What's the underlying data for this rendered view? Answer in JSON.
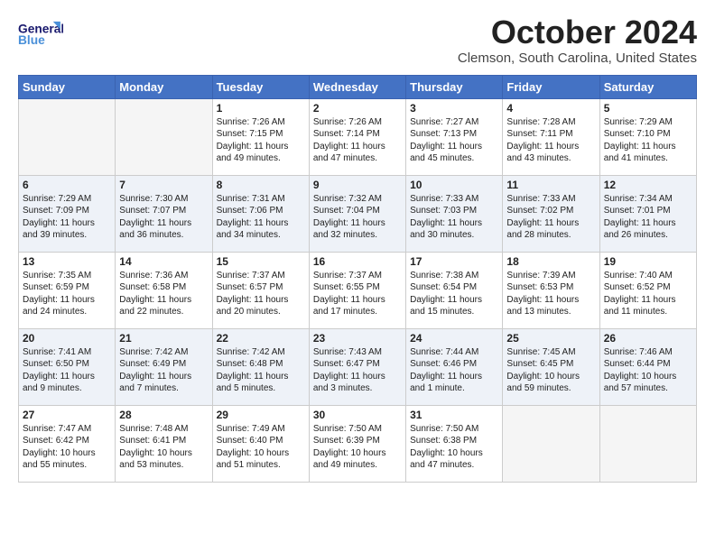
{
  "header": {
    "logo_general": "General",
    "logo_blue": "Blue",
    "month_title": "October 2024",
    "location": "Clemson, South Carolina, United States"
  },
  "days_of_week": [
    "Sunday",
    "Monday",
    "Tuesday",
    "Wednesday",
    "Thursday",
    "Friday",
    "Saturday"
  ],
  "weeks": [
    [
      {
        "day": "",
        "info": ""
      },
      {
        "day": "",
        "info": ""
      },
      {
        "day": "1",
        "info": "Sunrise: 7:26 AM\nSunset: 7:15 PM\nDaylight: 11 hours and 49 minutes."
      },
      {
        "day": "2",
        "info": "Sunrise: 7:26 AM\nSunset: 7:14 PM\nDaylight: 11 hours and 47 minutes."
      },
      {
        "day": "3",
        "info": "Sunrise: 7:27 AM\nSunset: 7:13 PM\nDaylight: 11 hours and 45 minutes."
      },
      {
        "day": "4",
        "info": "Sunrise: 7:28 AM\nSunset: 7:11 PM\nDaylight: 11 hours and 43 minutes."
      },
      {
        "day": "5",
        "info": "Sunrise: 7:29 AM\nSunset: 7:10 PM\nDaylight: 11 hours and 41 minutes."
      }
    ],
    [
      {
        "day": "6",
        "info": "Sunrise: 7:29 AM\nSunset: 7:09 PM\nDaylight: 11 hours and 39 minutes."
      },
      {
        "day": "7",
        "info": "Sunrise: 7:30 AM\nSunset: 7:07 PM\nDaylight: 11 hours and 36 minutes."
      },
      {
        "day": "8",
        "info": "Sunrise: 7:31 AM\nSunset: 7:06 PM\nDaylight: 11 hours and 34 minutes."
      },
      {
        "day": "9",
        "info": "Sunrise: 7:32 AM\nSunset: 7:04 PM\nDaylight: 11 hours and 32 minutes."
      },
      {
        "day": "10",
        "info": "Sunrise: 7:33 AM\nSunset: 7:03 PM\nDaylight: 11 hours and 30 minutes."
      },
      {
        "day": "11",
        "info": "Sunrise: 7:33 AM\nSunset: 7:02 PM\nDaylight: 11 hours and 28 minutes."
      },
      {
        "day": "12",
        "info": "Sunrise: 7:34 AM\nSunset: 7:01 PM\nDaylight: 11 hours and 26 minutes."
      }
    ],
    [
      {
        "day": "13",
        "info": "Sunrise: 7:35 AM\nSunset: 6:59 PM\nDaylight: 11 hours and 24 minutes."
      },
      {
        "day": "14",
        "info": "Sunrise: 7:36 AM\nSunset: 6:58 PM\nDaylight: 11 hours and 22 minutes."
      },
      {
        "day": "15",
        "info": "Sunrise: 7:37 AM\nSunset: 6:57 PM\nDaylight: 11 hours and 20 minutes."
      },
      {
        "day": "16",
        "info": "Sunrise: 7:37 AM\nSunset: 6:55 PM\nDaylight: 11 hours and 17 minutes."
      },
      {
        "day": "17",
        "info": "Sunrise: 7:38 AM\nSunset: 6:54 PM\nDaylight: 11 hours and 15 minutes."
      },
      {
        "day": "18",
        "info": "Sunrise: 7:39 AM\nSunset: 6:53 PM\nDaylight: 11 hours and 13 minutes."
      },
      {
        "day": "19",
        "info": "Sunrise: 7:40 AM\nSunset: 6:52 PM\nDaylight: 11 hours and 11 minutes."
      }
    ],
    [
      {
        "day": "20",
        "info": "Sunrise: 7:41 AM\nSunset: 6:50 PM\nDaylight: 11 hours and 9 minutes."
      },
      {
        "day": "21",
        "info": "Sunrise: 7:42 AM\nSunset: 6:49 PM\nDaylight: 11 hours and 7 minutes."
      },
      {
        "day": "22",
        "info": "Sunrise: 7:42 AM\nSunset: 6:48 PM\nDaylight: 11 hours and 5 minutes."
      },
      {
        "day": "23",
        "info": "Sunrise: 7:43 AM\nSunset: 6:47 PM\nDaylight: 11 hours and 3 minutes."
      },
      {
        "day": "24",
        "info": "Sunrise: 7:44 AM\nSunset: 6:46 PM\nDaylight: 11 hours and 1 minute."
      },
      {
        "day": "25",
        "info": "Sunrise: 7:45 AM\nSunset: 6:45 PM\nDaylight: 10 hours and 59 minutes."
      },
      {
        "day": "26",
        "info": "Sunrise: 7:46 AM\nSunset: 6:44 PM\nDaylight: 10 hours and 57 minutes."
      }
    ],
    [
      {
        "day": "27",
        "info": "Sunrise: 7:47 AM\nSunset: 6:42 PM\nDaylight: 10 hours and 55 minutes."
      },
      {
        "day": "28",
        "info": "Sunrise: 7:48 AM\nSunset: 6:41 PM\nDaylight: 10 hours and 53 minutes."
      },
      {
        "day": "29",
        "info": "Sunrise: 7:49 AM\nSunset: 6:40 PM\nDaylight: 10 hours and 51 minutes."
      },
      {
        "day": "30",
        "info": "Sunrise: 7:50 AM\nSunset: 6:39 PM\nDaylight: 10 hours and 49 minutes."
      },
      {
        "day": "31",
        "info": "Sunrise: 7:50 AM\nSunset: 6:38 PM\nDaylight: 10 hours and 47 minutes."
      },
      {
        "day": "",
        "info": ""
      },
      {
        "day": "",
        "info": ""
      }
    ]
  ]
}
